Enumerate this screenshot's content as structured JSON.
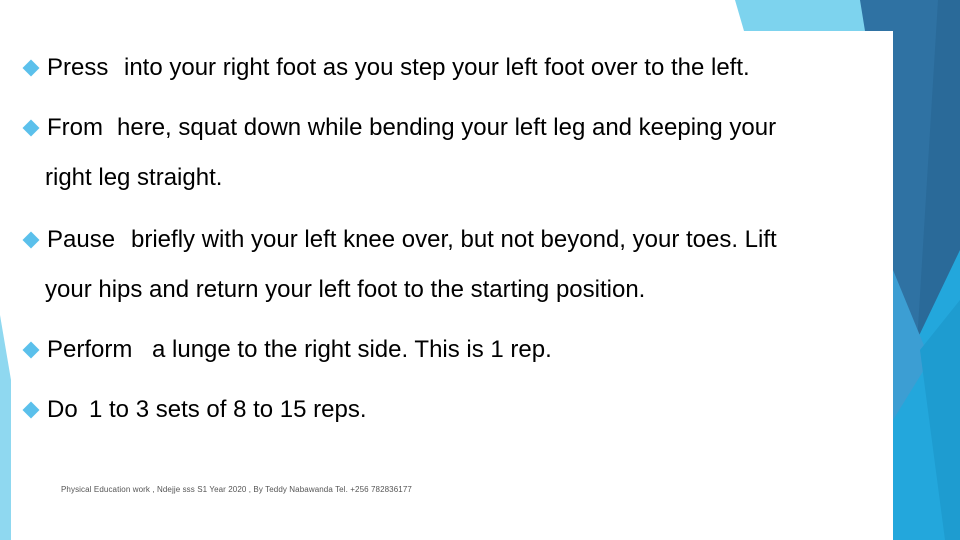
{
  "slide": {
    "bullet_icon": "diamond-bullet-icon",
    "colors": {
      "bullet": "#5BC0EB",
      "accent_light": "#7DD3EE",
      "accent_mid": "#2AA5DA",
      "accent_dark": "#2E6E9E",
      "text": "#000000"
    },
    "bullets": [
      {
        "first_word": "Press",
        "lines": [
          "into your right foot as you step your left foot over to the left."
        ]
      },
      {
        "first_word": "From",
        "lines": [
          "here, squat down while bending your left leg and keeping your",
          "right leg straight."
        ]
      },
      {
        "first_word": "Pause",
        "lines": [
          "briefly with your left knee over, but not beyond, your toes. Lift",
          "your hips and return your left foot to the starting position."
        ]
      },
      {
        "first_word": "Perform",
        "lines": [
          "a lunge to the right side. This is 1 rep."
        ]
      },
      {
        "first_word": "Do",
        "lines": [
          "1 to 3 sets of 8 to 15 reps."
        ]
      }
    ],
    "footer": "Physical Education work , Ndejje sss S1 Year 2020 , By Teddy Nabawanda  Tel. +256 782836177"
  }
}
